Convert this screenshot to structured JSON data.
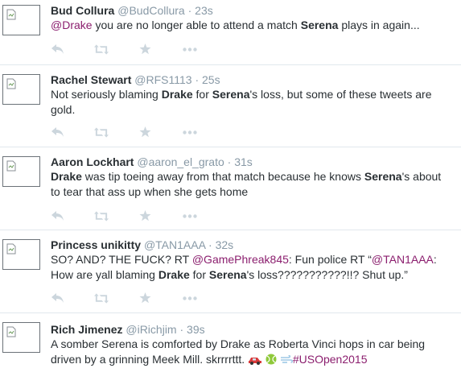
{
  "icons": {
    "reply": "reply-icon",
    "retweet": "retweet-icon",
    "favorite": "star-icon",
    "more": "more-icon"
  },
  "colors": {
    "text": "#292f33",
    "meta": "#8899a6",
    "mention": "#8b1e6e",
    "divider": "#e1e8ed",
    "action_icon": "#ccd6dd"
  },
  "tweets": [
    {
      "name": "Bud Collura",
      "handle": "@BudCollura",
      "separator": "·",
      "time": "23s",
      "body": {
        "mention": "@Drake",
        "t1": " you are no longer able to attend a match ",
        "b1": "Serena",
        "t2": " plays in again..."
      }
    },
    {
      "name": "Rachel Stewart",
      "handle": "@RFS1113",
      "separator": "·",
      "time": "25s",
      "body": {
        "t1": "Not seriously blaming ",
        "b1": "Drake",
        "t2": " for ",
        "b2": "Serena",
        "t3": "'s loss, but some of these tweets are gold."
      }
    },
    {
      "name": "Aaron Lockhart",
      "handle": "@aaron_el_grato",
      "separator": "·",
      "time": "31s",
      "body": {
        "b1": "Drake",
        "t1": " was tip toeing away from that match because he knows ",
        "b2": "Serena",
        "t2": "'s about to tear that ass up when she gets home"
      }
    },
    {
      "name": "Princess unikitty",
      "handle": "@TAN1AAA",
      "separator": "·",
      "time": "32s",
      "body": {
        "t1": "SO? AND? THE FUCK? RT ",
        "m1": "@GamePhreak845",
        "t2": ": Fun police RT “",
        "m2": "@TAN1AAA",
        "t3": ": How are yall blaming ",
        "b1": "Drake",
        "t4": " for ",
        "b2": "Serena",
        "t5": "'s loss???????????!!? Shut up.”"
      }
    },
    {
      "name": "Rich Jimenez",
      "handle": "@iRichjim",
      "separator": "·",
      "time": "39s",
      "body": {
        "t1": "A somber Serena is comforted by Drake as Roberta Vinci hops in car being driven by a grinning Meek Mill. skrrrrttt. ",
        "emojis": [
          "car-emoji",
          "tennis-ball-emoji",
          "dash-emoji"
        ],
        "hashtag": "#USOpen2015"
      }
    }
  ]
}
